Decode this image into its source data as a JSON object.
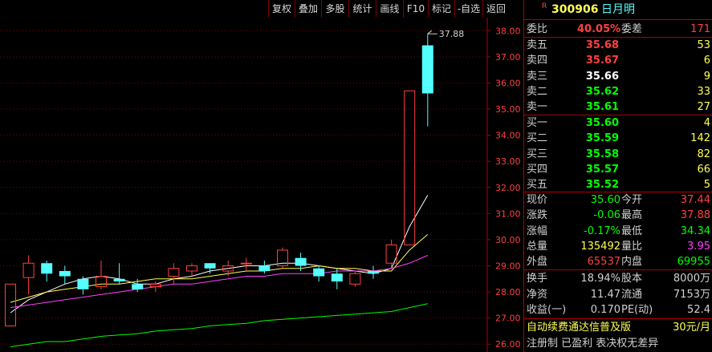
{
  "toolbar": {
    "buttons": [
      "复权",
      "叠加",
      "多股",
      "统计",
      "画线",
      "F10",
      "标记",
      "-自选",
      "返回"
    ]
  },
  "stock": {
    "marker": "R",
    "code": "300906",
    "name": "日月明"
  },
  "committee": {
    "ratio_label": "委比",
    "ratio": "40.05%",
    "diff_label": "委差",
    "diff": "171"
  },
  "asks": [
    {
      "label": "卖五",
      "price": "35.68",
      "vol": "53"
    },
    {
      "label": "卖四",
      "price": "35.67",
      "vol": "6"
    },
    {
      "label": "卖三",
      "price": "35.66",
      "vol": "9"
    },
    {
      "label": "卖二",
      "price": "35.62",
      "vol": "33"
    },
    {
      "label": "卖一",
      "price": "35.61",
      "vol": "27"
    }
  ],
  "bids": [
    {
      "label": "买一",
      "price": "35.60",
      "vol": "4"
    },
    {
      "label": "买二",
      "price": "35.59",
      "vol": "142"
    },
    {
      "label": "买三",
      "price": "35.58",
      "vol": "82"
    },
    {
      "label": "买四",
      "price": "35.57",
      "vol": "66"
    },
    {
      "label": "买五",
      "price": "35.52",
      "vol": "5"
    }
  ],
  "quote": [
    {
      "l1": "现价",
      "v1": "35.60",
      "l2": "今开",
      "v2": "37.44"
    },
    {
      "l1": "涨跌",
      "v1": "-0.06",
      "l2": "最高",
      "v2": "37.88"
    },
    {
      "l1": "涨幅",
      "v1": "-0.17%",
      "l2": "最低",
      "v2": "34.34"
    },
    {
      "l1": "总量",
      "v1": "135492",
      "l2": "量比",
      "v2": "3.95"
    },
    {
      "l1": "外盘",
      "v1": "65537",
      "l2": "内盘",
      "v2": "69955"
    }
  ],
  "stats": [
    {
      "l1": "换手",
      "v1": "18.94%",
      "l2": "股本",
      "v2": "8000万"
    },
    {
      "l1": "净资",
      "v1": "11.47",
      "l2": "流通",
      "v2": "7153万"
    },
    {
      "l1": "收益(一)",
      "v1": "0.170",
      "l2": "PE(动)",
      "v2": "52.4"
    }
  ],
  "footer": {
    "line1": "自动续费通达信普及版",
    "price": "30元/月",
    "line2": "注册制 已盈利 表决权无差异"
  },
  "colors": {
    "up": "#ff4040",
    "down": "#54ffff",
    "flat": "#ffffff",
    "ma5": "#ffffff",
    "ma10": "#ffff55",
    "ma20": "#ff40ff",
    "ma60": "#00ff00",
    "volume": "#ffff55",
    "ratio": "#ff4040"
  },
  "chart_data": {
    "type": "candlestick",
    "ylim": [
      25.7,
      38.5
    ],
    "yticks": [
      "38.00",
      "37.00",
      "36.00",
      "35.00",
      "34.00",
      "33.00",
      "32.00",
      "31.00",
      "30.00",
      "29.00",
      "28.00",
      "27.00",
      "26.00"
    ],
    "high_label": "37.88",
    "candles": [
      {
        "o": 26.7,
        "c": 28.3,
        "h": 28.3,
        "l": 26.7
      },
      {
        "o": 28.55,
        "c": 29.1,
        "h": 29.4,
        "l": 27.9
      },
      {
        "o": 29.1,
        "c": 28.7,
        "h": 29.2,
        "l": 28.4
      },
      {
        "o": 28.8,
        "c": 28.6,
        "h": 29.0,
        "l": 28.3
      },
      {
        "o": 28.5,
        "c": 28.1,
        "h": 28.6,
        "l": 27.9
      },
      {
        "o": 28.2,
        "c": 28.6,
        "h": 29.2,
        "l": 28.1
      },
      {
        "o": 28.5,
        "c": 28.4,
        "h": 29.1,
        "l": 28.3
      },
      {
        "o": 28.3,
        "c": 28.1,
        "h": 28.5,
        "l": 28.0
      },
      {
        "o": 28.2,
        "c": 28.3,
        "h": 28.4,
        "l": 28.0
      },
      {
        "o": 28.6,
        "c": 28.9,
        "h": 29.1,
        "l": 28.3
      },
      {
        "o": 28.8,
        "c": 29.0,
        "h": 29.1,
        "l": 28.6
      },
      {
        "o": 29.1,
        "c": 28.9,
        "h": 29.1,
        "l": 28.7
      },
      {
        "o": 28.8,
        "c": 29.0,
        "h": 29.2,
        "l": 28.6
      },
      {
        "o": 29.1,
        "c": 29.1,
        "h": 29.3,
        "l": 28.8
      },
      {
        "o": 29.0,
        "c": 28.8,
        "h": 29.2,
        "l": 28.7
      },
      {
        "o": 29.0,
        "c": 29.6,
        "h": 29.7,
        "l": 28.9
      },
      {
        "o": 29.3,
        "c": 29.0,
        "h": 29.5,
        "l": 28.8
      },
      {
        "o": 28.9,
        "c": 28.6,
        "h": 29.0,
        "l": 28.4
      },
      {
        "o": 28.7,
        "c": 28.4,
        "h": 28.9,
        "l": 28.1
      },
      {
        "o": 28.3,
        "c": 28.7,
        "h": 28.8,
        "l": 28.2
      },
      {
        "o": 28.8,
        "c": 28.7,
        "h": 29.0,
        "l": 28.5
      },
      {
        "o": 29.1,
        "c": 29.8,
        "h": 30.0,
        "l": 28.9
      },
      {
        "o": 29.8,
        "c": 35.7,
        "h": 35.7,
        "l": 29.8
      },
      {
        "o": 37.44,
        "c": 35.6,
        "h": 37.88,
        "l": 34.34
      }
    ],
    "ma": [
      {
        "name": "MA5",
        "color": "#ffffff",
        "values": [
          27.2,
          27.7,
          28.0,
          28.3,
          28.5,
          28.6,
          28.5,
          28.3,
          28.3,
          28.5,
          28.6,
          28.8,
          28.9,
          29.0,
          29.0,
          29.1,
          29.1,
          29.0,
          28.9,
          28.8,
          28.7,
          28.9,
          30.5,
          31.7
        ]
      },
      {
        "name": "MA10",
        "color": "#ffff55",
        "values": [
          27.6,
          27.8,
          28.0,
          28.1,
          28.2,
          28.3,
          28.3,
          28.4,
          28.5,
          28.5,
          28.5,
          28.6,
          28.7,
          28.8,
          28.8,
          28.9,
          28.9,
          29.0,
          28.9,
          28.9,
          28.8,
          28.8,
          29.6,
          30.2
        ]
      },
      {
        "name": "MA20",
        "color": "#ff40ff",
        "values": [
          27.4,
          27.5,
          27.6,
          27.7,
          27.8,
          27.9,
          28.0,
          28.1,
          28.2,
          28.3,
          28.3,
          28.4,
          28.5,
          28.6,
          28.6,
          28.7,
          28.7,
          28.7,
          28.8,
          28.8,
          28.8,
          28.9,
          29.1,
          29.4
        ]
      },
      {
        "name": "MA60",
        "color": "#00ff00",
        "values": [
          25.9,
          26.0,
          26.1,
          26.1,
          26.2,
          26.3,
          26.35,
          26.4,
          26.5,
          26.55,
          26.6,
          26.7,
          26.75,
          26.8,
          26.9,
          26.95,
          27.0,
          27.05,
          27.1,
          27.15,
          27.2,
          27.25,
          27.4,
          27.55
        ]
      }
    ]
  }
}
